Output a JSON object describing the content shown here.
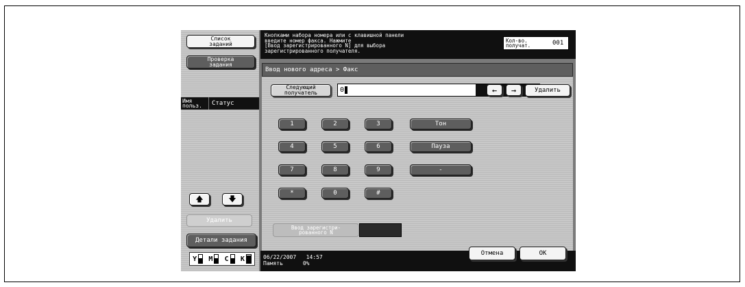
{
  "left_panel": {
    "job_list_label": "Список\nзаданий",
    "job_check_label": "Проверка\nзадания",
    "col_user": "Имя\nпольз.",
    "col_status": "Статус",
    "delete_label": "Удалить",
    "job_details_label": "Детали задания",
    "toner": [
      {
        "color": "Y",
        "level": 0.6
      },
      {
        "color": "M",
        "level": 0.6
      },
      {
        "color": "C",
        "level": 0.6
      },
      {
        "color": "K",
        "level": 0.9
      }
    ]
  },
  "message": {
    "text": "Кнопками набора номера или с клавишной панели\nвведите номер факса. Нажмите\n[Ввод зарегистрированного N] для выбора\nзарегистрированного получателя.",
    "recipients_label": "Кол-во.\nполучат.",
    "recipients_count": "001"
  },
  "breadcrumb": "Ввод нового адреса > Факс",
  "entry": {
    "next_recipient_label": "Следующий\nполучатель",
    "value": "0",
    "left_arrow": "←",
    "right_arrow": "→",
    "delete_label": "Удалить"
  },
  "keypad": {
    "keys": [
      "1",
      "2",
      "3",
      "4",
      "5",
      "6",
      "7",
      "8",
      "9",
      "*",
      "0",
      "#"
    ],
    "tone_label": "Тон",
    "pause_label": "Пауза",
    "dash_label": "-"
  },
  "registered": {
    "label": "Ввод зарегистри-\nрованного N"
  },
  "footer": {
    "date": "06/22/2007",
    "time": "14:57",
    "memory_label": "Память",
    "memory_value": "0%",
    "cancel_label": "Отмена",
    "ok_label": "OK"
  }
}
